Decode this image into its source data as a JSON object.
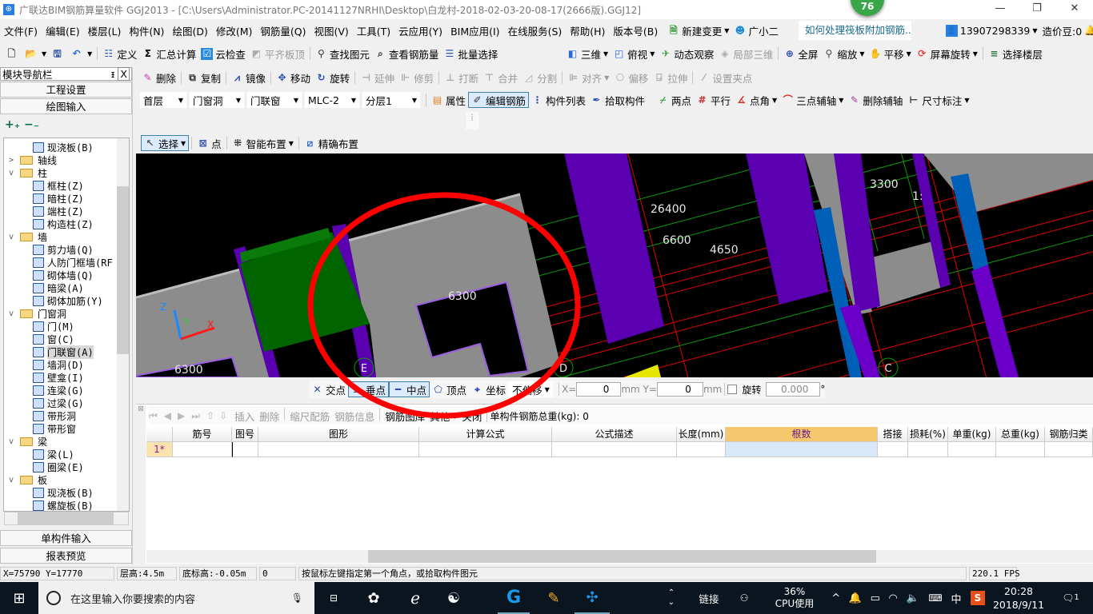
{
  "title": {
    "text": "广联达BIM钢筋算量软件 GGJ2013 - [C:\\Users\\Administrator.PC-20141127NRHI\\Desktop\\白龙村-2018-02-03-20-08-17(2666版).GGJ12]",
    "badge": "76",
    "controls": [
      "—",
      "❐",
      "✕"
    ]
  },
  "menu": [
    "文件(F)",
    "编辑(E)",
    "楼层(L)",
    "构件(N)",
    "绘图(D)",
    "修改(M)",
    "钢筋量(Q)",
    "视图(V)",
    "工具(T)",
    "云应用(Y)",
    "BIM应用(I)",
    "在线服务(S)",
    "帮助(H)",
    "版本号(B)"
  ],
  "menu_right": {
    "new_change": "新建变更",
    "assistant": "广小二",
    "question": "如何处理筏板附加钢筋..",
    "phone": "13907298339",
    "beans": "造价豆:0"
  },
  "toolbar1": [
    {
      "icon": "new-file",
      "label": ""
    },
    {
      "icon": "open-folder",
      "label": "",
      "dd": true
    },
    {
      "icon": "save",
      "label": ""
    },
    {
      "icon": "undo",
      "label": "",
      "dd": true
    },
    {
      "icon": "define",
      "label": "定义"
    },
    {
      "icon": "sigma",
      "label": "汇总计算"
    },
    {
      "icon": "cloud-check",
      "label": "云检查"
    },
    {
      "icon": "align-slab",
      "label": "平齐板顶",
      "dis": true
    },
    {
      "icon": "find",
      "label": "查找图元"
    },
    {
      "icon": "view-rebar",
      "label": "查看钢筋量"
    },
    {
      "icon": "batch-select",
      "label": "批量选择"
    }
  ],
  "toolbar1b": [
    {
      "icon": "3d",
      "label": "三维",
      "dd": true
    },
    {
      "icon": "top-view",
      "label": "俯视",
      "dd": true
    },
    {
      "icon": "orbit",
      "label": "动态观察"
    },
    {
      "icon": "local-3d",
      "label": "局部三维",
      "dis": true
    },
    {
      "icon": "fullscreen",
      "label": "全屏"
    },
    {
      "icon": "zoom",
      "label": "缩放",
      "dd": true
    },
    {
      "icon": "pan",
      "label": "平移",
      "dd": true
    },
    {
      "icon": "rotate-screen",
      "label": "屏幕旋转",
      "dd": true
    },
    {
      "icon": "select-floor",
      "label": "选择楼层"
    }
  ],
  "sidebar": {
    "title": "模块导航栏",
    "pin": "ᵻ",
    "close": "X",
    "project_settings": "工程设置",
    "drawing_input": "绘图输入",
    "expand": "+₊",
    "collapse": "−₋",
    "single_input": "单构件输入",
    "report": "报表预览",
    "tree": [
      {
        "label": "现浇板(B)",
        "lvl": 1
      },
      {
        "label": "轴线",
        "lvl": 0,
        "tw": ">"
      },
      {
        "label": "柱",
        "lvl": 0,
        "tw": "v"
      },
      {
        "label": "框柱(Z)",
        "lvl": 1
      },
      {
        "label": "暗柱(Z)",
        "lvl": 1
      },
      {
        "label": "端柱(Z)",
        "lvl": 1
      },
      {
        "label": "构造柱(Z)",
        "lvl": 1
      },
      {
        "label": "墙",
        "lvl": 0,
        "tw": "v"
      },
      {
        "label": "剪力墙(Q)",
        "lvl": 1
      },
      {
        "label": "人防门框墙(RF",
        "lvl": 1
      },
      {
        "label": "砌体墙(Q)",
        "lvl": 1
      },
      {
        "label": "暗梁(A)",
        "lvl": 1
      },
      {
        "label": "砌体加筋(Y)",
        "lvl": 1
      },
      {
        "label": "门窗洞",
        "lvl": 0,
        "tw": "v"
      },
      {
        "label": "门(M)",
        "lvl": 1
      },
      {
        "label": "窗(C)",
        "lvl": 1
      },
      {
        "label": "门联窗(A)",
        "lvl": 1,
        "sel": true
      },
      {
        "label": "墙洞(D)",
        "lvl": 1
      },
      {
        "label": "壁龛(I)",
        "lvl": 1
      },
      {
        "label": "连梁(G)",
        "lvl": 1
      },
      {
        "label": "过梁(G)",
        "lvl": 1
      },
      {
        "label": "带形洞",
        "lvl": 1
      },
      {
        "label": "带形窗",
        "lvl": 1
      },
      {
        "label": "梁",
        "lvl": 0,
        "tw": "v"
      },
      {
        "label": "梁(L)",
        "lvl": 1
      },
      {
        "label": "圈梁(E)",
        "lvl": 1
      },
      {
        "label": "板",
        "lvl": 0,
        "tw": "v"
      },
      {
        "label": "现浇板(B)",
        "lvl": 1
      },
      {
        "label": "螺旋板(B)",
        "lvl": 1
      }
    ]
  },
  "toolbar2": [
    {
      "icon": "delete",
      "label": "删除"
    },
    {
      "icon": "copy",
      "label": "复制"
    },
    {
      "icon": "mirror",
      "label": "镜像"
    },
    {
      "icon": "move",
      "label": "移动"
    },
    {
      "icon": "rotate",
      "label": "旋转"
    },
    {
      "icon": "extend",
      "label": "延伸",
      "dis": true
    },
    {
      "icon": "trim",
      "label": "修剪",
      "dis": true
    },
    {
      "icon": "break",
      "label": "打断",
      "dis": true
    },
    {
      "icon": "merge",
      "label": "合并",
      "dis": true
    },
    {
      "icon": "split",
      "label": "分割",
      "dis": true
    },
    {
      "icon": "align",
      "label": "对齐",
      "dd": true,
      "dis": true
    },
    {
      "icon": "offset",
      "label": "偏移",
      "dis": true
    },
    {
      "icon": "stretch",
      "label": "拉伸",
      "dis": true
    },
    {
      "icon": "grip",
      "label": "设置夹点",
      "dis": true
    }
  ],
  "combos": [
    "首层",
    "门窗洞",
    "门联窗",
    "MLC-2",
    "分层1"
  ],
  "toolbar3": [
    {
      "icon": "property",
      "label": "属性"
    },
    {
      "icon": "edit-rebar",
      "label": "编辑钢筋",
      "sel": true
    },
    {
      "icon": "component-list",
      "label": "构件列表"
    },
    {
      "icon": "pick",
      "label": "拾取构件"
    }
  ],
  "toolbar3b": [
    {
      "icon": "two-point",
      "label": "两点"
    },
    {
      "icon": "parallel",
      "label": "平行"
    },
    {
      "icon": "point-angle",
      "label": "点角",
      "dd": true
    },
    {
      "icon": "three-point-axis",
      "label": "三点辅轴",
      "dd": true
    },
    {
      "icon": "delete-axis",
      "label": "删除辅轴"
    },
    {
      "icon": "dimension",
      "label": "尺寸标注",
      "dd": true
    }
  ],
  "toolbar4": [
    {
      "icon": "pointer",
      "label": "选择",
      "dd": true,
      "sel": true
    },
    {
      "icon": "point",
      "label": "点"
    },
    {
      "icon": "smart-layout",
      "label": "智能布置",
      "dd": true
    },
    {
      "icon": "precise-layout",
      "label": "精确布置"
    }
  ],
  "canvas": {
    "dims": [
      "26400",
      "6600",
      "4650",
      "3300",
      "6300",
      "6300",
      "1:"
    ],
    "axes": [
      "E",
      "D",
      "C"
    ],
    "triad": [
      "Z",
      "Y",
      "X"
    ]
  },
  "snap": {
    "items": [
      {
        "icon": "intersection",
        "label": "交点"
      },
      {
        "icon": "perpendicular",
        "label": "垂点",
        "sel": true
      },
      {
        "icon": "midpoint",
        "label": "中点",
        "sel": true
      },
      {
        "icon": "vertex",
        "label": "顶点"
      },
      {
        "icon": "coordinate",
        "label": "坐标"
      }
    ],
    "offset_mode": "不偏移",
    "x_label": "X=",
    "x_value": "0",
    "y_label": "mm Y=",
    "y_value": "0",
    "mm": "mm",
    "rotate_label": "旋转",
    "rotate_value": "0.000",
    "deg": "°",
    "rotate_checked": false
  },
  "grid_toolbar": {
    "items": [
      {
        "label": "插入",
        "dis": true
      },
      {
        "label": "删除",
        "dis": true
      },
      {
        "label": "缩尺配筋",
        "dis": true
      },
      {
        "label": "钢筋信息",
        "dis": true
      },
      {
        "label": "钢筋图库",
        "dis": false
      },
      {
        "label": "其他",
        "dd": true
      },
      {
        "label": "关闭"
      }
    ],
    "total": "单构件钢筋总重(kg): 0"
  },
  "grid": {
    "columns": [
      "",
      "筋号",
      "图号",
      "图形",
      "计算公式",
      "公式描述",
      "长度(mm)",
      "根数",
      "搭接",
      "损耗(%)",
      "单重(kg)",
      "总重(kg)",
      "钢筋归类"
    ],
    "rows": [
      [
        "1*",
        "",
        "",
        "",
        "",
        "",
        "",
        "",
        "",
        "",
        "",
        "",
        ""
      ]
    ],
    "active_column": "根数"
  },
  "status": {
    "coords": "X=75790 Y=17770",
    "floor_height": "层高:4.5m",
    "bottom_elev": "底标高:-0.05m",
    "count": "0",
    "hint": "按鼠标左键指定第一个角点，或拾取构件图元",
    "fps": "220.1 FPS"
  },
  "taskbar": {
    "search": "在这里输入你要搜索的内容",
    "link": "链接",
    "cpu": "36%",
    "cpu_label": "CPU使用",
    "ime": "中",
    "time": "20:28",
    "date": "2018/9/11",
    "notif": "1"
  },
  "colors": {
    "canvas_bg": "#000000",
    "wall": "#8c8c8c",
    "column": "#5a00b0",
    "door_window": "#006400",
    "beam_blue": "#0060b8",
    "annotation_circle": "#ff0000",
    "active_header": "#f6c86e"
  }
}
